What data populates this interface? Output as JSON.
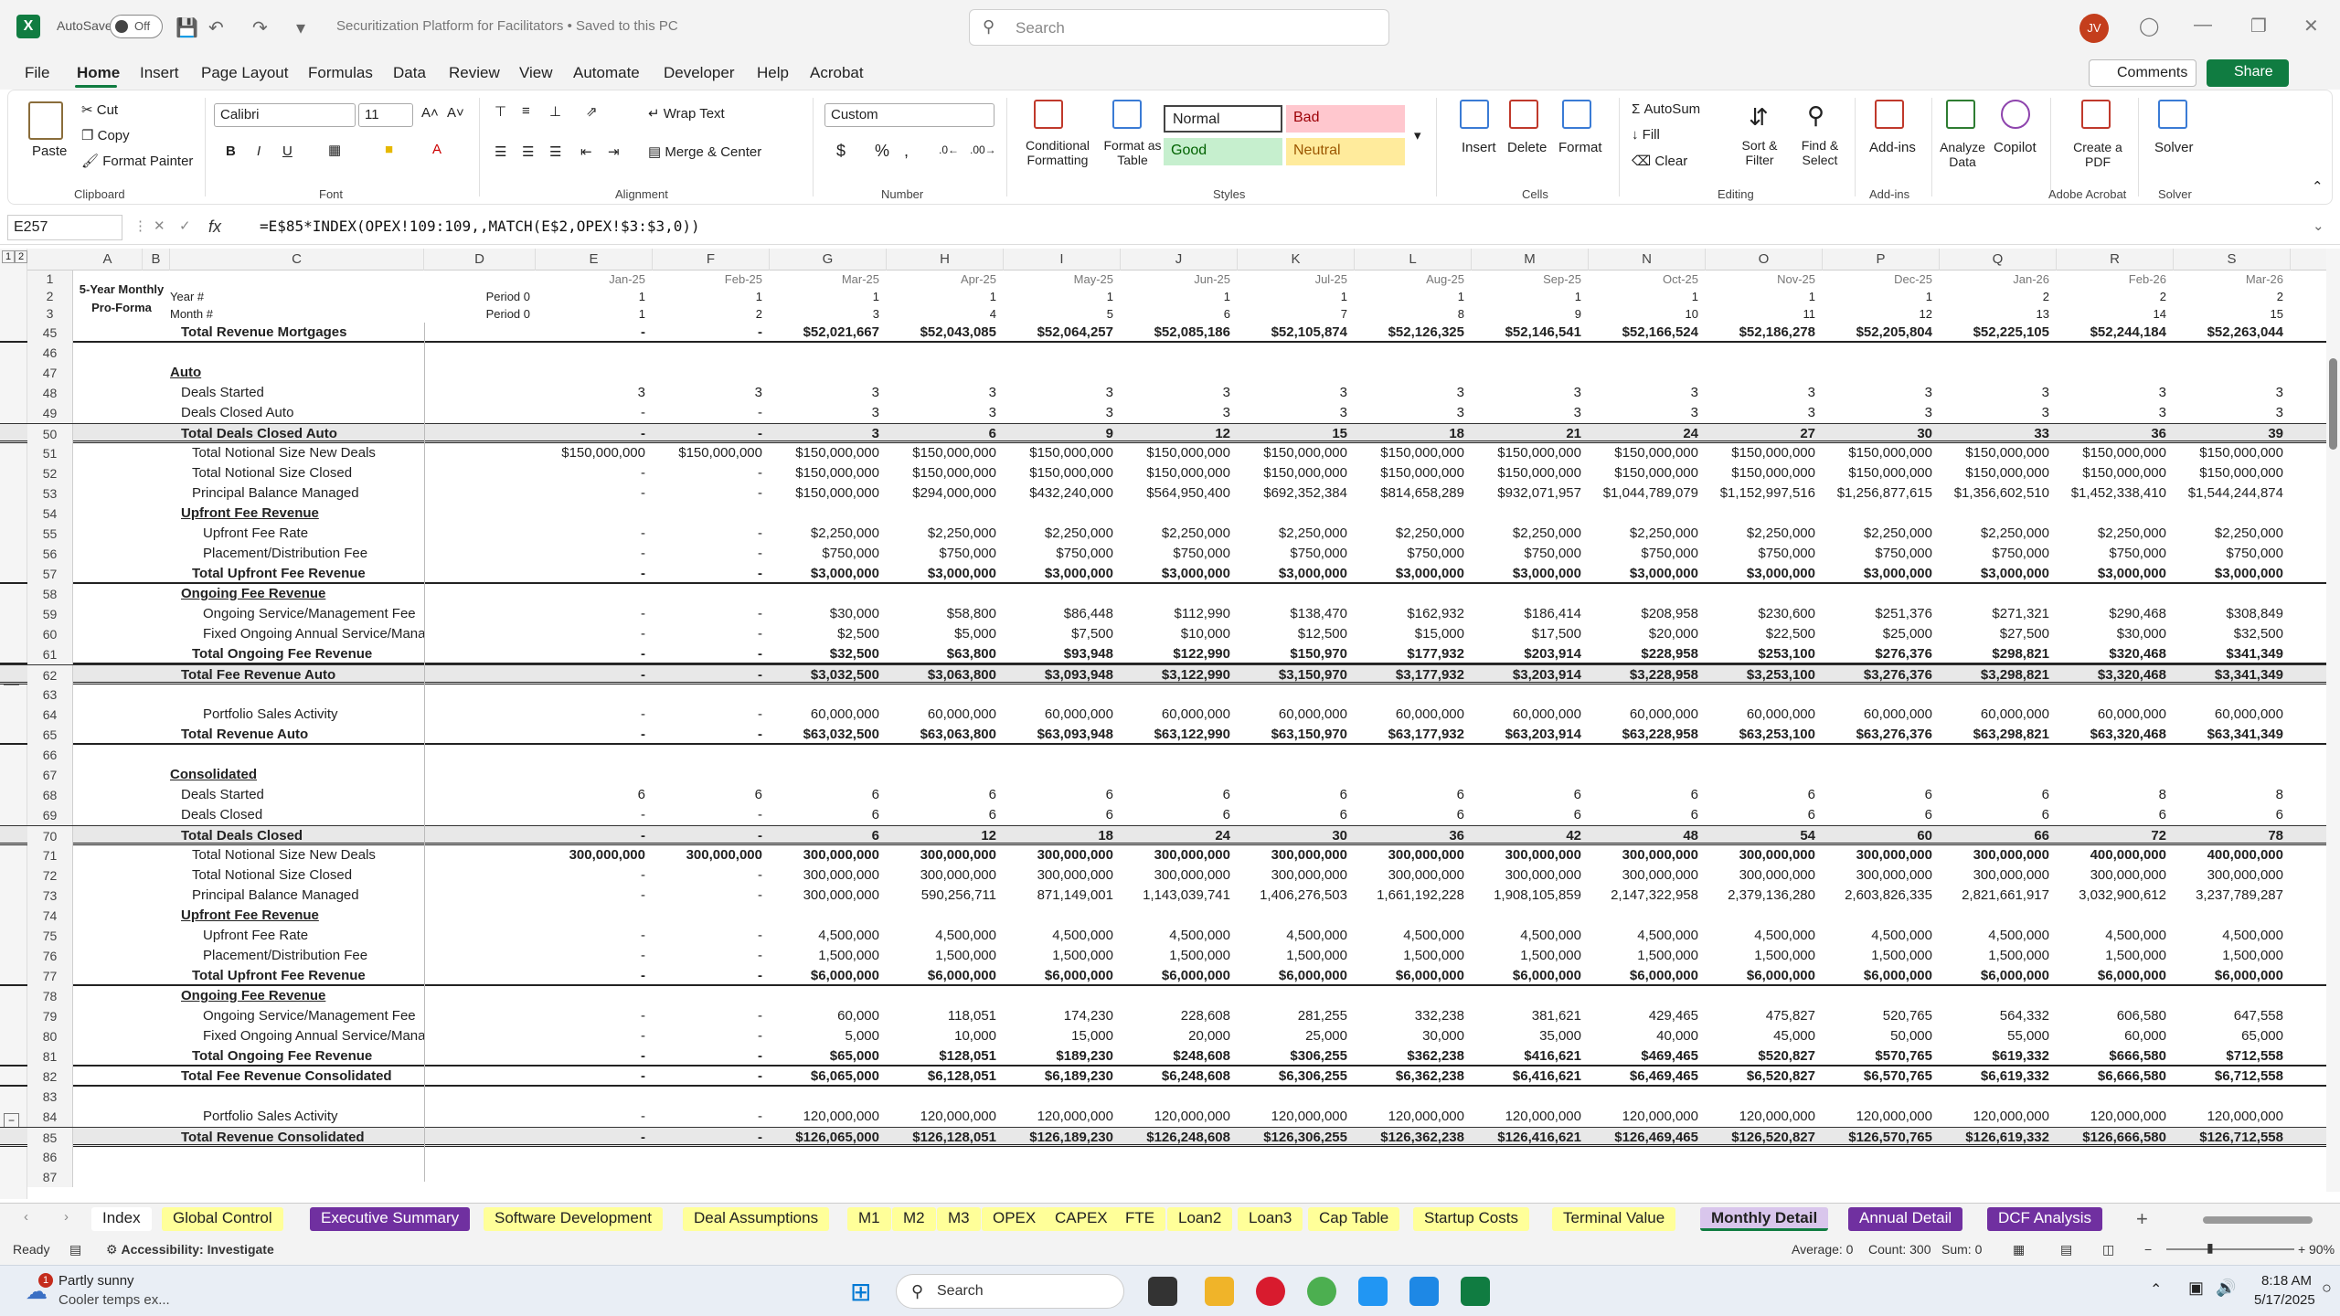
{
  "titlebar": {
    "autosave": "AutoSave",
    "toggle": "Off",
    "doc_title": "Securitization Platform for Facilitators  •  Saved to this PC",
    "search_placeholder": "Search",
    "avatar": "JV"
  },
  "menu": [
    "File",
    "Home",
    "Insert",
    "Page Layout",
    "Formulas",
    "Data",
    "Review",
    "View",
    "Automate",
    "Developer",
    "Help",
    "Acrobat"
  ],
  "menu_right": {
    "comments": "Comments",
    "share": "Share"
  },
  "ribbon": {
    "clipboard": {
      "paste": "Paste",
      "cut": "Cut",
      "copy": "Copy",
      "format_painter": "Format Painter",
      "label": "Clipboard"
    },
    "font": {
      "name": "Calibri",
      "size": "11",
      "label": "Font"
    },
    "alignment": {
      "wrap": "Wrap Text",
      "merge": "Merge & Center",
      "label": "Alignment"
    },
    "number": {
      "format": "Custom",
      "label": "Number"
    },
    "styles": {
      "conditional": "Conditional Formatting",
      "format_table": "Format as Table",
      "normal": "Normal",
      "bad": "Bad",
      "good": "Good",
      "neutral": "Neutral",
      "label": "Styles"
    },
    "cells": {
      "insert": "Insert",
      "delete": "Delete",
      "format": "Format",
      "label": "Cells"
    },
    "editing": {
      "autosum": "AutoSum",
      "fill": "Fill",
      "clear": "Clear",
      "sort": "Sort & Filter",
      "find": "Find & Select",
      "label": "Editing"
    },
    "addins": {
      "addins": "Add-ins",
      "label": "Add-ins"
    },
    "analyze": "Analyze Data",
    "copilot": "Copilot",
    "acrobat": {
      "create": "Create a PDF",
      "label": "Adobe Acrobat"
    },
    "solver": {
      "solver": "Solver",
      "label": "Solver"
    }
  },
  "formula_bar": {
    "cell_ref": "E257",
    "formula": "=E$85*INDEX(OPEX!109:109,,MATCH(E$2,OPEX!$3:$3,0))"
  },
  "columns": [
    "A",
    "B",
    "C",
    "D",
    "E",
    "F",
    "G",
    "H",
    "I",
    "J",
    "K",
    "L",
    "M",
    "N",
    "O",
    "P",
    "Q",
    "R",
    "S"
  ],
  "sheet_title": [
    "5-Year Monthly",
    "Pro-Forma"
  ],
  "header_rows": {
    "months": [
      "Jan-25",
      "Feb-25",
      "Mar-25",
      "Apr-25",
      "May-25",
      "Jun-25",
      "Jul-25",
      "Aug-25",
      "Sep-25",
      "Oct-25",
      "Nov-25",
      "Dec-25",
      "Jan-26",
      "Feb-26",
      "Mar-26"
    ],
    "year_label": "Year #",
    "year_period": "Period 0",
    "years": [
      "1",
      "1",
      "1",
      "1",
      "1",
      "1",
      "1",
      "1",
      "1",
      "1",
      "1",
      "1",
      "2",
      "2",
      "2"
    ],
    "month_label": "Month #",
    "month_period": "Period 0",
    "month_nums": [
      "1",
      "2",
      "3",
      "4",
      "5",
      "6",
      "7",
      "8",
      "9",
      "10",
      "11",
      "12",
      "13",
      "14",
      "15"
    ]
  },
  "rows": [
    {
      "n": "45",
      "label": "Total Revenue Mortgages",
      "style": "b",
      "indent": 1,
      "row": "bold",
      "v": [
        "-",
        "-",
        "$52,021,667",
        "$52,043,085",
        "$52,064,257",
        "$52,085,186",
        "$52,105,874",
        "$52,126,325",
        "$52,146,541",
        "$52,166,524",
        "$52,186,278",
        "$52,205,804",
        "$52,225,105",
        "$52,244,184",
        "$52,263,044"
      ]
    },
    {
      "n": "46",
      "label": "",
      "v": []
    },
    {
      "n": "47",
      "label": "Auto",
      "style": "u",
      "v": []
    },
    {
      "n": "48",
      "label": "Deals Started",
      "indent": 1,
      "v": [
        "3",
        "3",
        "3",
        "3",
        "3",
        "3",
        "3",
        "3",
        "3",
        "3",
        "3",
        "3",
        "3",
        "3",
        "3"
      ]
    },
    {
      "n": "49",
      "label": "Deals Closed Auto",
      "indent": 1,
      "v": [
        "-",
        "-",
        "3",
        "3",
        "3",
        "3",
        "3",
        "3",
        "3",
        "3",
        "3",
        "3",
        "3",
        "3",
        "3"
      ]
    },
    {
      "n": "50",
      "label": "Total Deals Closed Auto",
      "style": "b",
      "indent": 1,
      "row": "total",
      "v": [
        "-",
        "-",
        "3",
        "6",
        "9",
        "12",
        "15",
        "18",
        "21",
        "24",
        "27",
        "30",
        "33",
        "36",
        "39"
      ]
    },
    {
      "n": "51",
      "label": "Total Notional Size New Deals",
      "indent": 2,
      "v": [
        "$150,000,000",
        "$150,000,000",
        "$150,000,000",
        "$150,000,000",
        "$150,000,000",
        "$150,000,000",
        "$150,000,000",
        "$150,000,000",
        "$150,000,000",
        "$150,000,000",
        "$150,000,000",
        "$150,000,000",
        "$150,000,000",
        "$150,000,000",
        "$150,000,000"
      ]
    },
    {
      "n": "52",
      "label": "Total Notional Size Closed",
      "indent": 2,
      "v": [
        "-",
        "-",
        "$150,000,000",
        "$150,000,000",
        "$150,000,000",
        "$150,000,000",
        "$150,000,000",
        "$150,000,000",
        "$150,000,000",
        "$150,000,000",
        "$150,000,000",
        "$150,000,000",
        "$150,000,000",
        "$150,000,000",
        "$150,000,000"
      ]
    },
    {
      "n": "53",
      "label": "Principal Balance Managed",
      "indent": 2,
      "v": [
        "-",
        "-",
        "$150,000,000",
        "$294,000,000",
        "$432,240,000",
        "$564,950,400",
        "$692,352,384",
        "$814,658,289",
        "$932,071,957",
        "$1,044,789,079",
        "$1,152,997,516",
        "$1,256,877,615",
        "$1,356,602,510",
        "$1,452,338,410",
        "$1,544,244,874"
      ]
    },
    {
      "n": "54",
      "label": "Upfront Fee Revenue",
      "style": "u",
      "indent": 1,
      "v": []
    },
    {
      "n": "55",
      "label": "Upfront Fee Rate",
      "indent": 3,
      "v": [
        "-",
        "-",
        "$2,250,000",
        "$2,250,000",
        "$2,250,000",
        "$2,250,000",
        "$2,250,000",
        "$2,250,000",
        "$2,250,000",
        "$2,250,000",
        "$2,250,000",
        "$2,250,000",
        "$2,250,000",
        "$2,250,000",
        "$2,250,000"
      ]
    },
    {
      "n": "56",
      "label": "Placement/Distribution Fee",
      "indent": 3,
      "v": [
        "-",
        "-",
        "$750,000",
        "$750,000",
        "$750,000",
        "$750,000",
        "$750,000",
        "$750,000",
        "$750,000",
        "$750,000",
        "$750,000",
        "$750,000",
        "$750,000",
        "$750,000",
        "$750,000"
      ]
    },
    {
      "n": "57",
      "label": "Total Upfront Fee Revenue",
      "style": "b",
      "indent": 2,
      "row": "bold",
      "v": [
        "-",
        "-",
        "$3,000,000",
        "$3,000,000",
        "$3,000,000",
        "$3,000,000",
        "$3,000,000",
        "$3,000,000",
        "$3,000,000",
        "$3,000,000",
        "$3,000,000",
        "$3,000,000",
        "$3,000,000",
        "$3,000,000",
        "$3,000,000"
      ]
    },
    {
      "n": "58",
      "label": "Ongoing Fee Revenue",
      "style": "u",
      "indent": 1,
      "v": []
    },
    {
      "n": "59",
      "label": "Ongoing Service/Management Fee",
      "indent": 3,
      "v": [
        "-",
        "-",
        "$30,000",
        "$58,800",
        "$86,448",
        "$112,990",
        "$138,470",
        "$162,932",
        "$186,414",
        "$208,958",
        "$230,600",
        "$251,376",
        "$271,321",
        "$290,468",
        "$308,849"
      ]
    },
    {
      "n": "60",
      "label": "Fixed Ongoing Annual Service/Management Fee",
      "indent": 3,
      "v": [
        "-",
        "-",
        "$2,500",
        "$5,000",
        "$7,500",
        "$10,000",
        "$12,500",
        "$15,000",
        "$17,500",
        "$20,000",
        "$22,500",
        "$25,000",
        "$27,500",
        "$30,000",
        "$32,500"
      ]
    },
    {
      "n": "61",
      "label": "Total Ongoing Fee Revenue",
      "style": "b",
      "indent": 2,
      "row": "bold",
      "v": [
        "-",
        "-",
        "$32,500",
        "$63,800",
        "$93,948",
        "$122,990",
        "$150,970",
        "$177,932",
        "$203,914",
        "$228,958",
        "$253,100",
        "$276,376",
        "$298,821",
        "$320,468",
        "$341,349"
      ]
    },
    {
      "n": "62",
      "label": "Total Fee Revenue Auto",
      "style": "b",
      "indent": 1,
      "row": "total",
      "v": [
        "-",
        "-",
        "$3,032,500",
        "$3,063,800",
        "$3,093,948",
        "$3,122,990",
        "$3,150,970",
        "$3,177,932",
        "$3,203,914",
        "$3,228,958",
        "$3,253,100",
        "$3,276,376",
        "$3,298,821",
        "$3,320,468",
        "$3,341,349"
      ]
    },
    {
      "n": "63",
      "label": "",
      "v": []
    },
    {
      "n": "64",
      "label": "Portfolio Sales Activity",
      "indent": 3,
      "v": [
        "-",
        "-",
        "60,000,000",
        "60,000,000",
        "60,000,000",
        "60,000,000",
        "60,000,000",
        "60,000,000",
        "60,000,000",
        "60,000,000",
        "60,000,000",
        "60,000,000",
        "60,000,000",
        "60,000,000",
        "60,000,000"
      ]
    },
    {
      "n": "65",
      "label": "Total Revenue Auto",
      "style": "b",
      "indent": 1,
      "row": "bold",
      "v": [
        "-",
        "-",
        "$63,032,500",
        "$63,063,800",
        "$63,093,948",
        "$63,122,990",
        "$63,150,970",
        "$63,177,932",
        "$63,203,914",
        "$63,228,958",
        "$63,253,100",
        "$63,276,376",
        "$63,298,821",
        "$63,320,468",
        "$63,341,349"
      ]
    },
    {
      "n": "66",
      "label": "",
      "v": []
    },
    {
      "n": "67",
      "label": "Consolidated",
      "style": "u",
      "v": []
    },
    {
      "n": "68",
      "label": "Deals Started",
      "indent": 1,
      "v": [
        "6",
        "6",
        "6",
        "6",
        "6",
        "6",
        "6",
        "6",
        "6",
        "6",
        "6",
        "6",
        "6",
        "8",
        "8"
      ]
    },
    {
      "n": "69",
      "label": "Deals Closed",
      "indent": 1,
      "v": [
        "-",
        "-",
        "6",
        "6",
        "6",
        "6",
        "6",
        "6",
        "6",
        "6",
        "6",
        "6",
        "6",
        "6",
        "6"
      ]
    },
    {
      "n": "70",
      "label": "Total Deals Closed",
      "style": "b",
      "indent": 1,
      "row": "total",
      "v": [
        "-",
        "-",
        "6",
        "12",
        "18",
        "24",
        "30",
        "36",
        "42",
        "48",
        "54",
        "60",
        "66",
        "72",
        "78"
      ]
    },
    {
      "n": "71",
      "label": "Total Notional Size New Deals",
      "indent": 2,
      "v": [
        "300,000,000",
        "300,000,000",
        "300,000,000",
        "300,000,000",
        "300,000,000",
        "300,000,000",
        "300,000,000",
        "300,000,000",
        "300,000,000",
        "300,000,000",
        "300,000,000",
        "300,000,000",
        "300,000,000",
        "400,000,000",
        "400,000,000"
      ],
      "boldvals": true
    },
    {
      "n": "72",
      "label": "Total Notional Size Closed",
      "indent": 2,
      "v": [
        "-",
        "-",
        "300,000,000",
        "300,000,000",
        "300,000,000",
        "300,000,000",
        "300,000,000",
        "300,000,000",
        "300,000,000",
        "300,000,000",
        "300,000,000",
        "300,000,000",
        "300,000,000",
        "300,000,000",
        "300,000,000"
      ]
    },
    {
      "n": "73",
      "label": "Principal Balance Managed",
      "indent": 2,
      "v": [
        "-",
        "-",
        "300,000,000",
        "590,256,711",
        "871,149,001",
        "1,143,039,741",
        "1,406,276,503",
        "1,661,192,228",
        "1,908,105,859",
        "2,147,322,958",
        "2,379,136,280",
        "2,603,826,335",
        "2,821,661,917",
        "3,032,900,612",
        "3,237,789,287"
      ]
    },
    {
      "n": "74",
      "label": "Upfront Fee Revenue",
      "style": "u",
      "indent": 1,
      "v": []
    },
    {
      "n": "75",
      "label": "Upfront Fee Rate",
      "indent": 3,
      "v": [
        "-",
        "-",
        "4,500,000",
        "4,500,000",
        "4,500,000",
        "4,500,000",
        "4,500,000",
        "4,500,000",
        "4,500,000",
        "4,500,000",
        "4,500,000",
        "4,500,000",
        "4,500,000",
        "4,500,000",
        "4,500,000"
      ]
    },
    {
      "n": "76",
      "label": "Placement/Distribution Fee",
      "indent": 3,
      "v": [
        "-",
        "-",
        "1,500,000",
        "1,500,000",
        "1,500,000",
        "1,500,000",
        "1,500,000",
        "1,500,000",
        "1,500,000",
        "1,500,000",
        "1,500,000",
        "1,500,000",
        "1,500,000",
        "1,500,000",
        "1,500,000"
      ]
    },
    {
      "n": "77",
      "label": "Total Upfront Fee Revenue",
      "style": "b",
      "indent": 2,
      "row": "bold",
      "v": [
        "-",
        "-",
        "$6,000,000",
        "$6,000,000",
        "$6,000,000",
        "$6,000,000",
        "$6,000,000",
        "$6,000,000",
        "$6,000,000",
        "$6,000,000",
        "$6,000,000",
        "$6,000,000",
        "$6,000,000",
        "$6,000,000",
        "$6,000,000"
      ]
    },
    {
      "n": "78",
      "label": "Ongoing Fee Revenue",
      "style": "u",
      "indent": 1,
      "v": []
    },
    {
      "n": "79",
      "label": "Ongoing Service/Management Fee",
      "indent": 3,
      "v": [
        "-",
        "-",
        "60,000",
        "118,051",
        "174,230",
        "228,608",
        "281,255",
        "332,238",
        "381,621",
        "429,465",
        "475,827",
        "520,765",
        "564,332",
        "606,580",
        "647,558"
      ]
    },
    {
      "n": "80",
      "label": "Fixed Ongoing Annual Service/Management Fee",
      "indent": 3,
      "v": [
        "-",
        "-",
        "5,000",
        "10,000",
        "15,000",
        "20,000",
        "25,000",
        "30,000",
        "35,000",
        "40,000",
        "45,000",
        "50,000",
        "55,000",
        "60,000",
        "65,000"
      ]
    },
    {
      "n": "81",
      "label": "Total Ongoing Fee Revenue",
      "style": "b",
      "indent": 2,
      "row": "bold",
      "v": [
        "-",
        "-",
        "$65,000",
        "$128,051",
        "$189,230",
        "$248,608",
        "$306,255",
        "$362,238",
        "$416,621",
        "$469,465",
        "$520,827",
        "$570,765",
        "$619,332",
        "$666,580",
        "$712,558"
      ]
    },
    {
      "n": "82",
      "label": "Total Fee Revenue Consolidated",
      "style": "b",
      "indent": 1,
      "row": "bold",
      "v": [
        "-",
        "-",
        "$6,065,000",
        "$6,128,051",
        "$6,189,230",
        "$6,248,608",
        "$6,306,255",
        "$6,362,238",
        "$6,416,621",
        "$6,469,465",
        "$6,520,827",
        "$6,570,765",
        "$6,619,332",
        "$6,666,580",
        "$6,712,558"
      ]
    },
    {
      "n": "83",
      "label": "",
      "v": []
    },
    {
      "n": "84",
      "label": "Portfolio Sales Activity",
      "indent": 3,
      "v": [
        "-",
        "-",
        "120,000,000",
        "120,000,000",
        "120,000,000",
        "120,000,000",
        "120,000,000",
        "120,000,000",
        "120,000,000",
        "120,000,000",
        "120,000,000",
        "120,000,000",
        "120,000,000",
        "120,000,000",
        "120,000,000"
      ]
    },
    {
      "n": "85",
      "label": "Total Revenue Consolidated",
      "style": "b",
      "indent": 1,
      "row": "total",
      "v": [
        "-",
        "-",
        "$126,065,000",
        "$126,128,051",
        "$126,189,230",
        "$126,248,608",
        "$126,306,255",
        "$126,362,238",
        "$126,416,621",
        "$126,469,465",
        "$126,520,827",
        "$126,570,765",
        "$126,619,332",
        "$126,666,580",
        "$126,712,558"
      ]
    },
    {
      "n": "86",
      "label": "",
      "v": []
    },
    {
      "n": "87",
      "label": "",
      "v": []
    }
  ],
  "tabs": [
    {
      "label": "Index",
      "color": "#ffffff",
      "text": "#222"
    },
    {
      "label": "Global Control",
      "color": "#ffff99",
      "text": "#222"
    },
    {
      "label": "Executive Summary",
      "color": "#7030a0",
      "text": "#ffffff"
    },
    {
      "label": "Software Development",
      "color": "#ffff99",
      "text": "#222"
    },
    {
      "label": "Deal Assumptions",
      "color": "#ffff99",
      "text": "#222"
    },
    {
      "label": "M1",
      "color": "#ffff99",
      "text": "#222"
    },
    {
      "label": "M2",
      "color": "#ffff99",
      "text": "#222"
    },
    {
      "label": "M3",
      "color": "#ffff99",
      "text": "#222"
    },
    {
      "label": "OPEX",
      "color": "#ffff99",
      "text": "#222"
    },
    {
      "label": "CAPEX",
      "color": "#ffff99",
      "text": "#222"
    },
    {
      "label": "FTE",
      "color": "#ffff99",
      "text": "#222"
    },
    {
      "label": "Loan2",
      "color": "#ffff99",
      "text": "#222"
    },
    {
      "label": "Loan3",
      "color": "#ffff99",
      "text": "#222"
    },
    {
      "label": "Cap Table",
      "color": "#ffff99",
      "text": "#222"
    },
    {
      "label": "Startup Costs",
      "color": "#ffff99",
      "text": "#222"
    },
    {
      "label": "Terminal Value",
      "color": "#ffff99",
      "text": "#222"
    },
    {
      "label": "Monthly Detail",
      "color": "#d9c6ec",
      "text": "#222",
      "active": true
    },
    {
      "label": "Annual Detail",
      "color": "#7030a0",
      "text": "#ffffff"
    },
    {
      "label": "DCF Analysis",
      "color": "#7030a0",
      "text": "#ffffff"
    }
  ],
  "status": {
    "ready": "Ready",
    "accessibility": "Accessibility: Investigate",
    "average": "Average: 0",
    "count": "Count: 300",
    "sum": "Sum: 0",
    "zoom": "90%"
  },
  "taskbar": {
    "weather1": "Partly sunny",
    "weather2": "Cooler temps ex...",
    "search": "Search",
    "time": "8:18 AM",
    "date": "5/17/2025",
    "badge": "1"
  }
}
